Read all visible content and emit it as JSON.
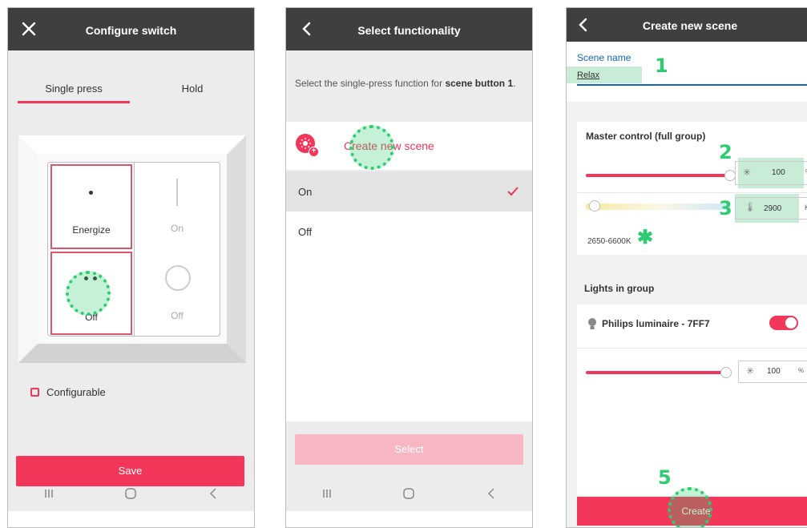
{
  "colors": {
    "accent": "#f2375a",
    "accent_disabled": "#f8b6c3",
    "annotation": "#2ecc71",
    "topbar": "#3f3f3f"
  },
  "screen1": {
    "title": "Configure switch",
    "close_icon": "close-icon",
    "tabs": [
      "Single press",
      "Hold"
    ],
    "buttons": {
      "energize": "Energize",
      "on": "On",
      "off_left": "Off",
      "off_right": "Off"
    },
    "configurable_label": "Configurable",
    "save_label": "Save"
  },
  "screen2": {
    "title": "Select functionality",
    "description_prefix": "Select the single-press function for ",
    "description_bold": "scene button 1",
    "description_suffix": ".",
    "create_scene_label": "Create new scene",
    "options": [
      {
        "label": "On",
        "selected": true
      },
      {
        "label": "Off",
        "selected": false
      }
    ],
    "select_label": "Select"
  },
  "screen3": {
    "title": "Create new scene",
    "scene_name_label": "Scene name",
    "scene_name_value": "Relax",
    "master_control_title": "Master control (full group)",
    "brightness_value": "100",
    "brightness_unit": "%",
    "brightness_level": 1.0,
    "temperature_value": "2900",
    "temperature_unit": "K",
    "temperature_level": 0.06,
    "temperature_range": "2650-6600K",
    "lights_title": "Lights in group",
    "light_name": "Philips luminaire - 7FF7",
    "light_on": true,
    "light_brightness_value": "100",
    "light_brightness_unit": "%",
    "light_brightness_level": 1.0,
    "create_label": "Create"
  },
  "annotations": [
    "1",
    "2",
    "3",
    "5"
  ]
}
